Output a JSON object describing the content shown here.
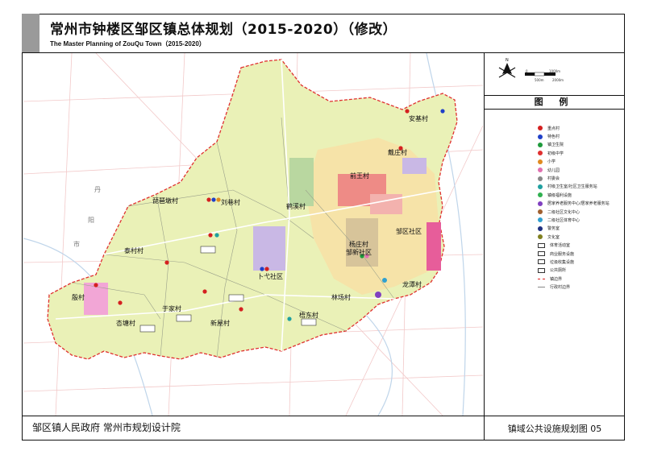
{
  "title": {
    "chinese": "常州市钟楼区邹区镇总体规划（2015-2020）（修改）",
    "english": "The Master Planning of ZouQu Town（2015-2020）"
  },
  "compass": {
    "icon": "north-arrow-icon",
    "scale_labels": [
      "0",
      "1000m",
      "500m",
      "2000m"
    ]
  },
  "legend": {
    "title": "图  例",
    "items": [
      {
        "label": "重点村",
        "icon": "red-circle-icon",
        "color": "#d42020"
      },
      {
        "label": "特色村",
        "icon": "blue-circle-icon",
        "color": "#2040c8"
      },
      {
        "label": "镇卫生院",
        "icon": "green-circle-icon",
        "color": "#1e9a3c"
      },
      {
        "label": "初级中学",
        "icon": "red-circle-icon",
        "color": "#e03030"
      },
      {
        "label": "小学",
        "icon": "orange-circle-icon",
        "color": "#e08a20"
      },
      {
        "label": "幼儿园",
        "icon": "pink-circle-icon",
        "color": "#e070b0"
      },
      {
        "label": "村委会",
        "icon": "grey-circle-icon",
        "color": "#888888"
      },
      {
        "label": "村级卫生室/社区卫生服务站",
        "icon": "teal-circle-icon",
        "color": "#20a0a0"
      },
      {
        "label": "镇级福利设施",
        "icon": "green-circle-icon",
        "color": "#30b050"
      },
      {
        "label": "居家养老服务中心/居家养老服务站",
        "icon": "purple-circle-icon",
        "color": "#8040c0"
      },
      {
        "label": "二级社区文化中心",
        "icon": "brown-circle-icon",
        "color": "#a06030"
      },
      {
        "label": "二级社区体育中心",
        "icon": "cyan-circle-icon",
        "color": "#30a0d0"
      },
      {
        "label": "警务室",
        "icon": "navy-circle-icon",
        "color": "#203080"
      },
      {
        "label": "文化室",
        "icon": "olive-circle-icon",
        "color": "#808020"
      },
      {
        "label": "体育活动室",
        "icon": "dark-square-icon",
        "color": "#333333"
      },
      {
        "label": "商业服务设施",
        "icon": "dark-square-icon",
        "color": "#333333"
      },
      {
        "label": "垃圾收集设施",
        "icon": "dark-square-icon",
        "color": "#333333"
      },
      {
        "label": "公共厕所",
        "icon": "dark-square-icon",
        "color": "#333333"
      },
      {
        "label": "镇边界",
        "icon": "red-dash-line-icon",
        "color": "#e02020"
      },
      {
        "label": "行政村边界",
        "icon": "grey-line-icon",
        "color": "#888888"
      }
    ]
  },
  "map": {
    "village_labels": [
      {
        "text": "琵琶墩村"
      },
      {
        "text": "刘巷村"
      },
      {
        "text": "鹤溪村"
      },
      {
        "text": "前王村"
      },
      {
        "text": "戴庄村"
      },
      {
        "text": "安基村"
      },
      {
        "text": "泰村村"
      },
      {
        "text": "邹区社区"
      },
      {
        "text": "杨庄村"
      },
      {
        "text": "邹新社区"
      },
      {
        "text": "卜弋社区"
      },
      {
        "text": "殷村"
      },
      {
        "text": "于家村"
      },
      {
        "text": "新屋村"
      },
      {
        "text": "杏塘村"
      },
      {
        "text": "林场村"
      },
      {
        "text": "龙潭村"
      },
      {
        "text": "梧东村"
      }
    ],
    "side_labels": [
      {
        "text": "丹"
      },
      {
        "text": "阳"
      },
      {
        "text": "市"
      }
    ]
  },
  "footer": {
    "left": "邹区镇人民政府   常州市规划设计院",
    "right": "镇域公共设施规划图 05"
  }
}
